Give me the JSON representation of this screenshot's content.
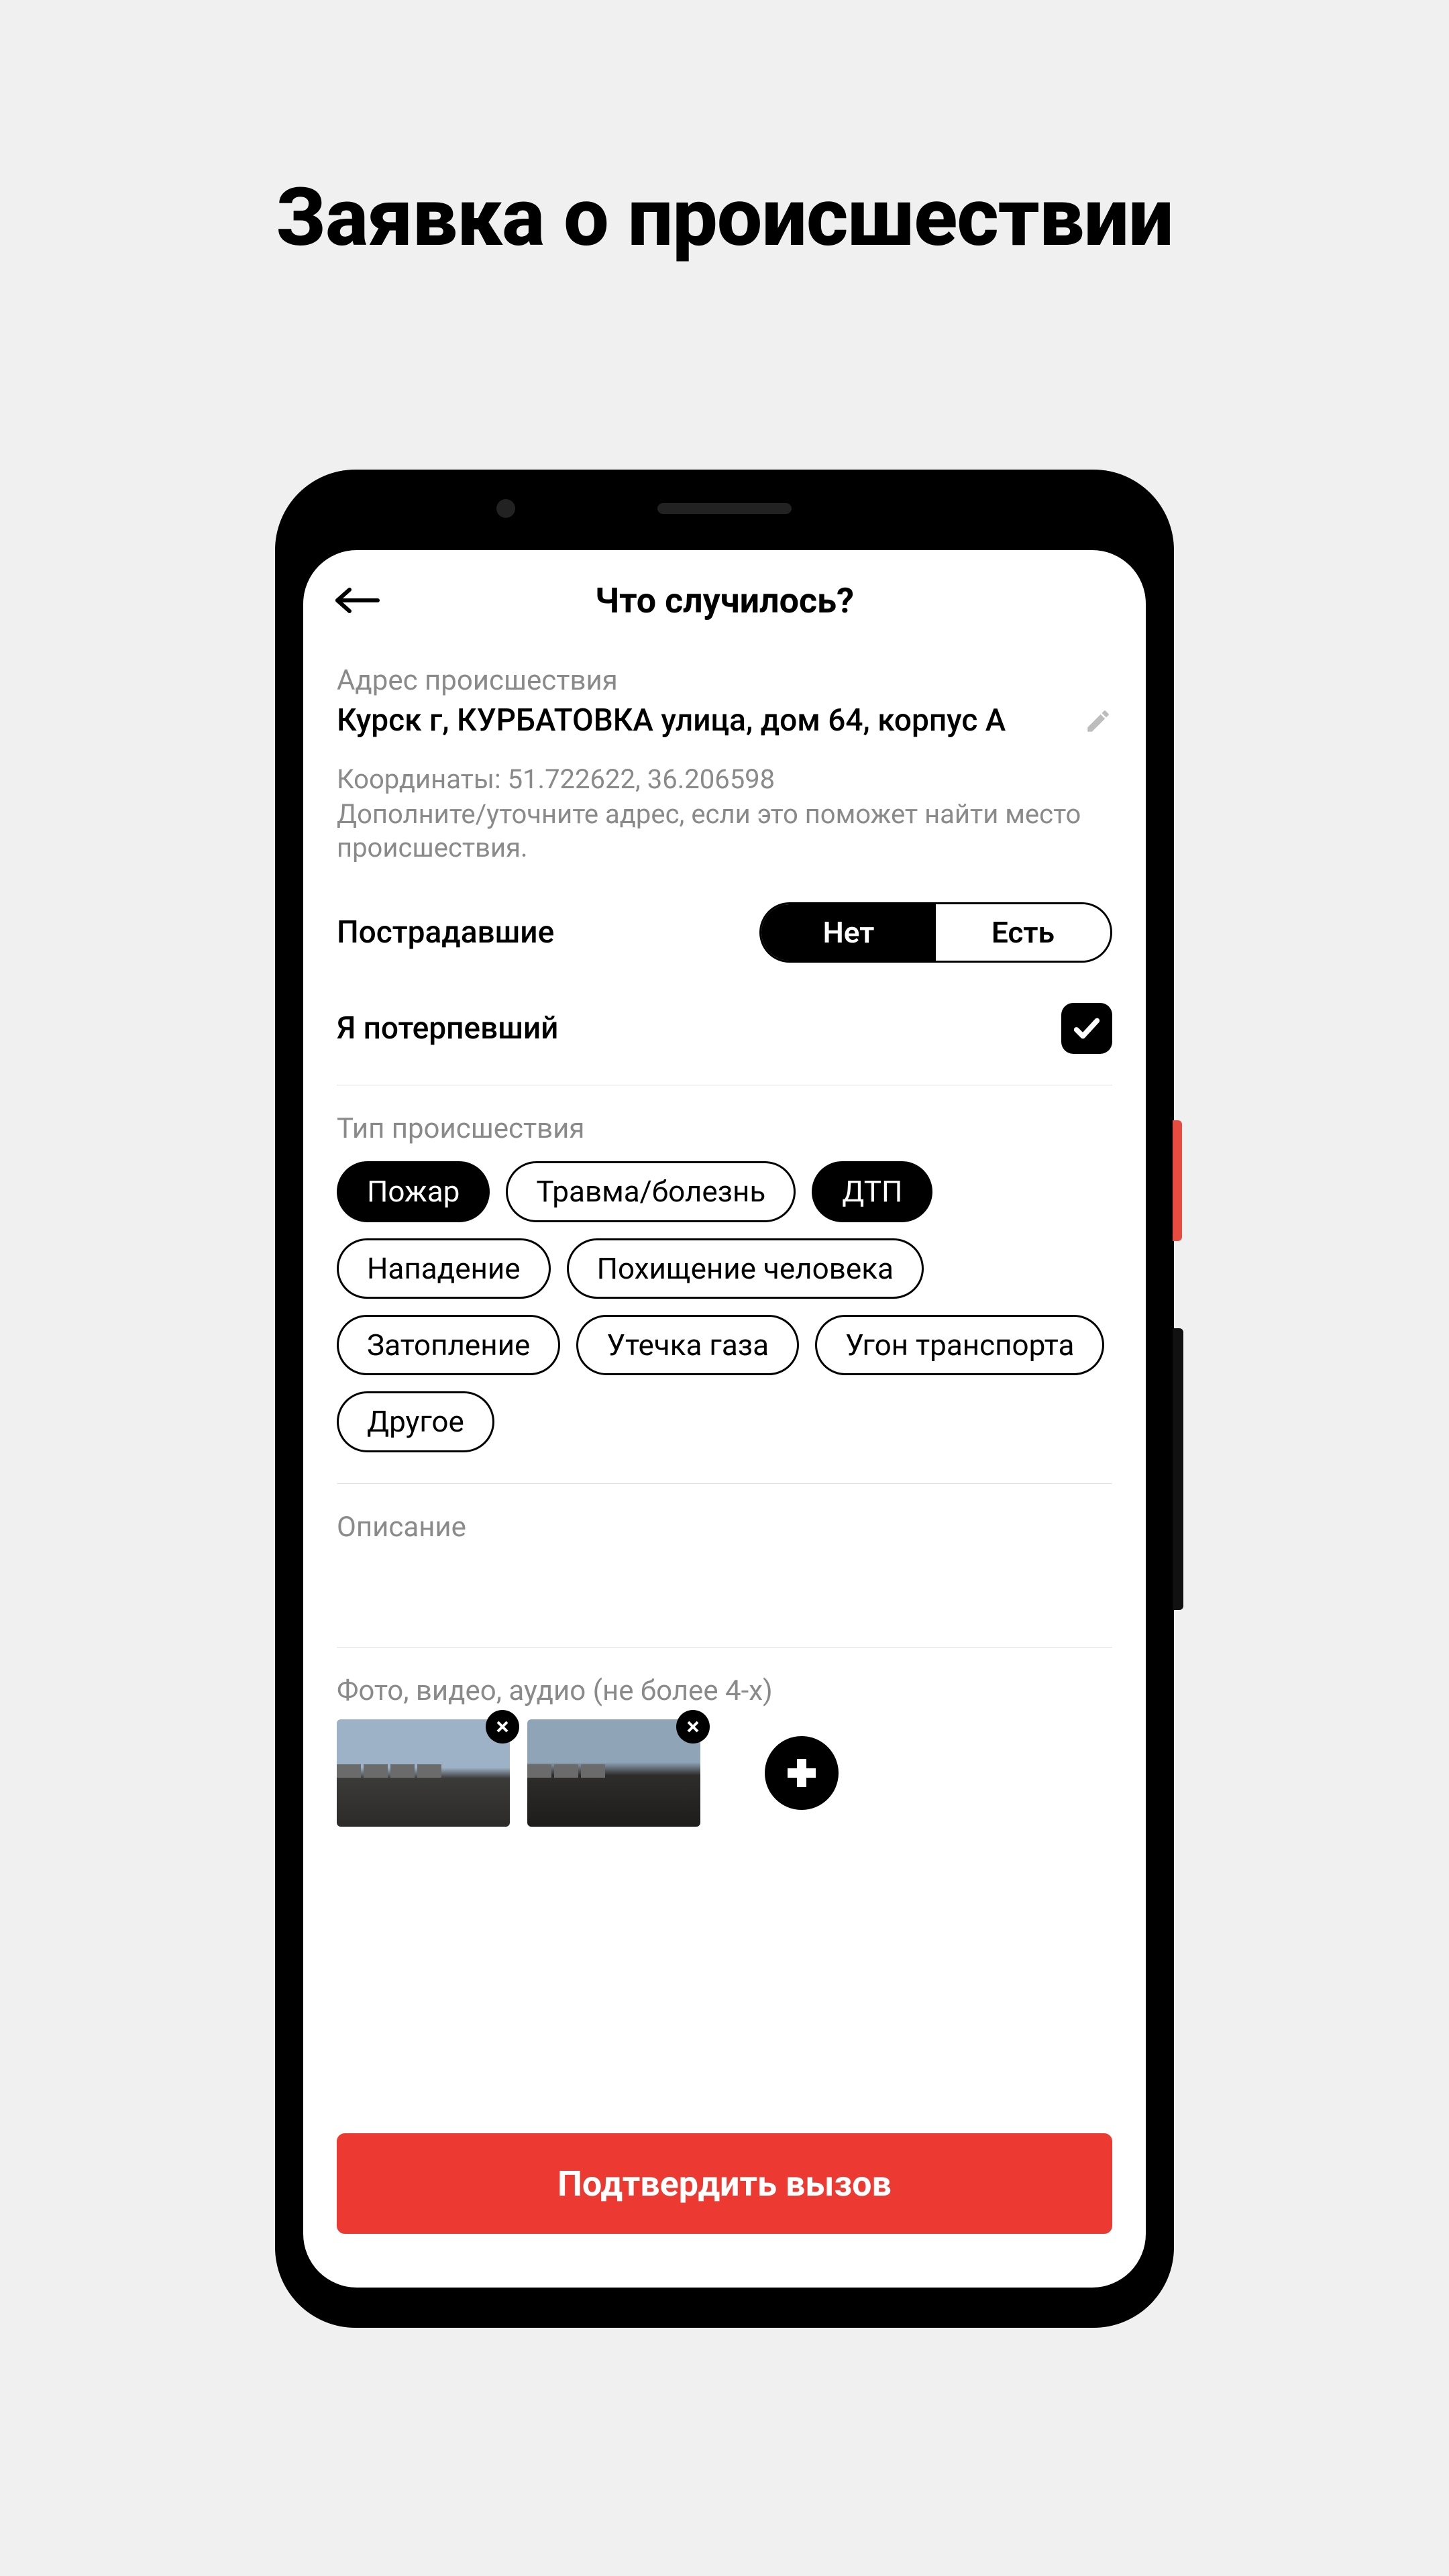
{
  "marketing_title": "Заявка о происшествии",
  "header": {
    "title": "Что случилось?"
  },
  "address": {
    "label": "Адрес происшествия",
    "value": "Курск г, КУРБАТОВКА улица, дом 64, корпус А"
  },
  "coordinates": {
    "prefix": "Координаты: ",
    "value": "51.722622, 36.206598"
  },
  "address_hint": "Дополните/уточните адрес, если это поможет найти место происшествия.",
  "victims": {
    "label": "Пострадавшие",
    "option_no": "Нет",
    "option_yes": "Есть",
    "selected": "Нет"
  },
  "iam_victim": {
    "label": "Я потерпевший",
    "checked": true
  },
  "incident_type": {
    "label": "Тип происшествия",
    "options": [
      {
        "label": "Пожар",
        "selected": true
      },
      {
        "label": "Травма/болезнь",
        "selected": false
      },
      {
        "label": "ДТП",
        "selected": true
      },
      {
        "label": "Нападение",
        "selected": false
      },
      {
        "label": "Похищение человека",
        "selected": false
      },
      {
        "label": "Затопление",
        "selected": false
      },
      {
        "label": "Утечка газа",
        "selected": false
      },
      {
        "label": "Угон транспорта",
        "selected": false
      },
      {
        "label": "Другое",
        "selected": false
      }
    ]
  },
  "description": {
    "label": "Описание",
    "value": ""
  },
  "media": {
    "label": "Фото, видео, аудио (не более 4-х)",
    "count": 2
  },
  "confirm_button": "Подтвердить вызов"
}
